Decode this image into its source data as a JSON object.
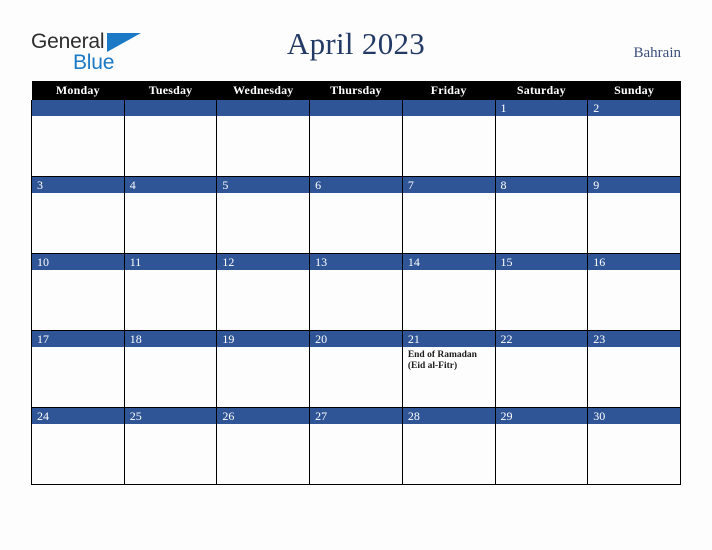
{
  "brand": {
    "name_part1": "General",
    "name_part2": "Blue"
  },
  "header": {
    "title": "April 2023",
    "country": "Bahrain"
  },
  "calendar": {
    "weekday_headers": [
      "Monday",
      "Tuesday",
      "Wednesday",
      "Thursday",
      "Friday",
      "Saturday",
      "Sunday"
    ],
    "colors": {
      "header_bg": "#000000",
      "daynum_bg": "#2f5596",
      "title_color": "#243a66",
      "brand_blue": "#1b79c6",
      "page_bg": "#fdfdfd"
    },
    "weeks": [
      [
        {
          "day": "",
          "events": []
        },
        {
          "day": "",
          "events": []
        },
        {
          "day": "",
          "events": []
        },
        {
          "day": "",
          "events": []
        },
        {
          "day": "",
          "events": []
        },
        {
          "day": "1",
          "events": []
        },
        {
          "day": "2",
          "events": []
        }
      ],
      [
        {
          "day": "3",
          "events": []
        },
        {
          "day": "4",
          "events": []
        },
        {
          "day": "5",
          "events": []
        },
        {
          "day": "6",
          "events": []
        },
        {
          "day": "7",
          "events": []
        },
        {
          "day": "8",
          "events": []
        },
        {
          "day": "9",
          "events": []
        }
      ],
      [
        {
          "day": "10",
          "events": []
        },
        {
          "day": "11",
          "events": []
        },
        {
          "day": "12",
          "events": []
        },
        {
          "day": "13",
          "events": []
        },
        {
          "day": "14",
          "events": []
        },
        {
          "day": "15",
          "events": []
        },
        {
          "day": "16",
          "events": []
        }
      ],
      [
        {
          "day": "17",
          "events": []
        },
        {
          "day": "18",
          "events": []
        },
        {
          "day": "19",
          "events": []
        },
        {
          "day": "20",
          "events": []
        },
        {
          "day": "21",
          "events": [
            "End of Ramadan",
            "(Eid al-Fitr)"
          ]
        },
        {
          "day": "22",
          "events": []
        },
        {
          "day": "23",
          "events": []
        }
      ],
      [
        {
          "day": "24",
          "events": []
        },
        {
          "day": "25",
          "events": []
        },
        {
          "day": "26",
          "events": []
        },
        {
          "day": "27",
          "events": []
        },
        {
          "day": "28",
          "events": []
        },
        {
          "day": "29",
          "events": []
        },
        {
          "day": "30",
          "events": []
        }
      ]
    ]
  }
}
